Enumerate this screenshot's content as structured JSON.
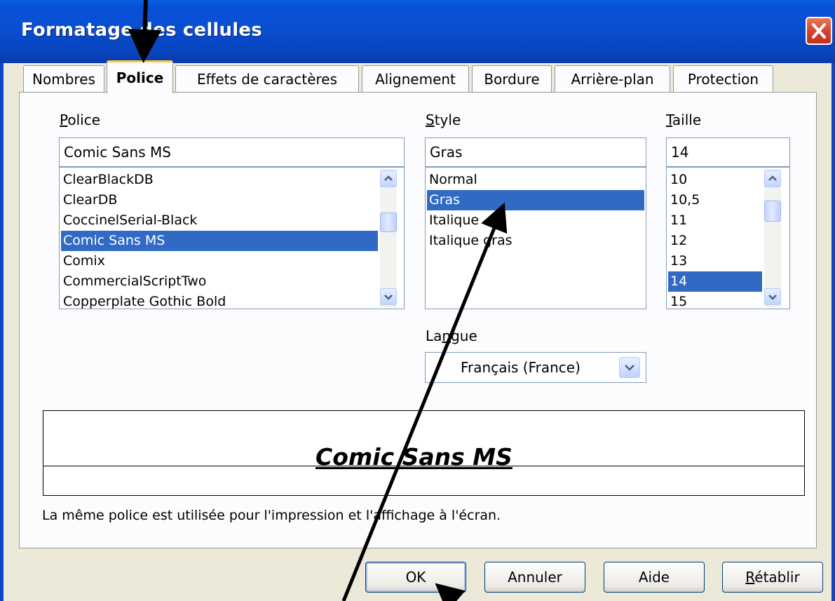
{
  "window": {
    "title": "Formatage des cellules",
    "close_label": "×"
  },
  "tabs": [
    {
      "label": "Nombres"
    },
    {
      "label": "Police"
    },
    {
      "label": "Effets de caractères"
    },
    {
      "label": "Alignement"
    },
    {
      "label": "Bordure"
    },
    {
      "label": "Arrière-plan"
    },
    {
      "label": "Protection"
    }
  ],
  "font": {
    "label_first": "P",
    "label_rest": "olice",
    "value": "Comic Sans MS",
    "items": [
      "ClearBlackDB",
      "ClearDB",
      "CoccinelSerial-Black",
      "Comic Sans MS",
      "Comix",
      "CommercialScriptTwo",
      "Copperplate Gothic Bold"
    ],
    "selected": "Comic Sans MS"
  },
  "style": {
    "label_first": "S",
    "label_rest": "tyle",
    "value": "Gras",
    "items": [
      "Normal",
      "Gras",
      "Italique",
      "Italique gras"
    ],
    "selected": "Gras"
  },
  "size": {
    "label_first": "T",
    "label_rest": "aille",
    "value": "14",
    "items": [
      "10",
      "10,5",
      "11",
      "12",
      "13",
      "14",
      "15"
    ],
    "selected": "14"
  },
  "language": {
    "label_a": "La",
    "label_u": "n",
    "label_b": "gue",
    "value": "Français (France)"
  },
  "preview": {
    "text": "Comic Sans MS"
  },
  "note": "La même police est utilisée pour l'impression et l'affichage à l'écran.",
  "buttons": {
    "ok": "OK",
    "cancel": "Annuler",
    "help": "Aide",
    "reset_first": "R",
    "reset_rest": "établir"
  },
  "colors": {
    "titlebar": "#0a4fd2",
    "selection": "#316ac5",
    "dialog_bg": "#ece9d8",
    "tab_highlight": "#ffc83c",
    "close_button": "#d4402a"
  },
  "icons": [
    "close-icon",
    "scroll-up-icon",
    "scroll-down-icon",
    "dropdown-arrow-icon"
  ]
}
